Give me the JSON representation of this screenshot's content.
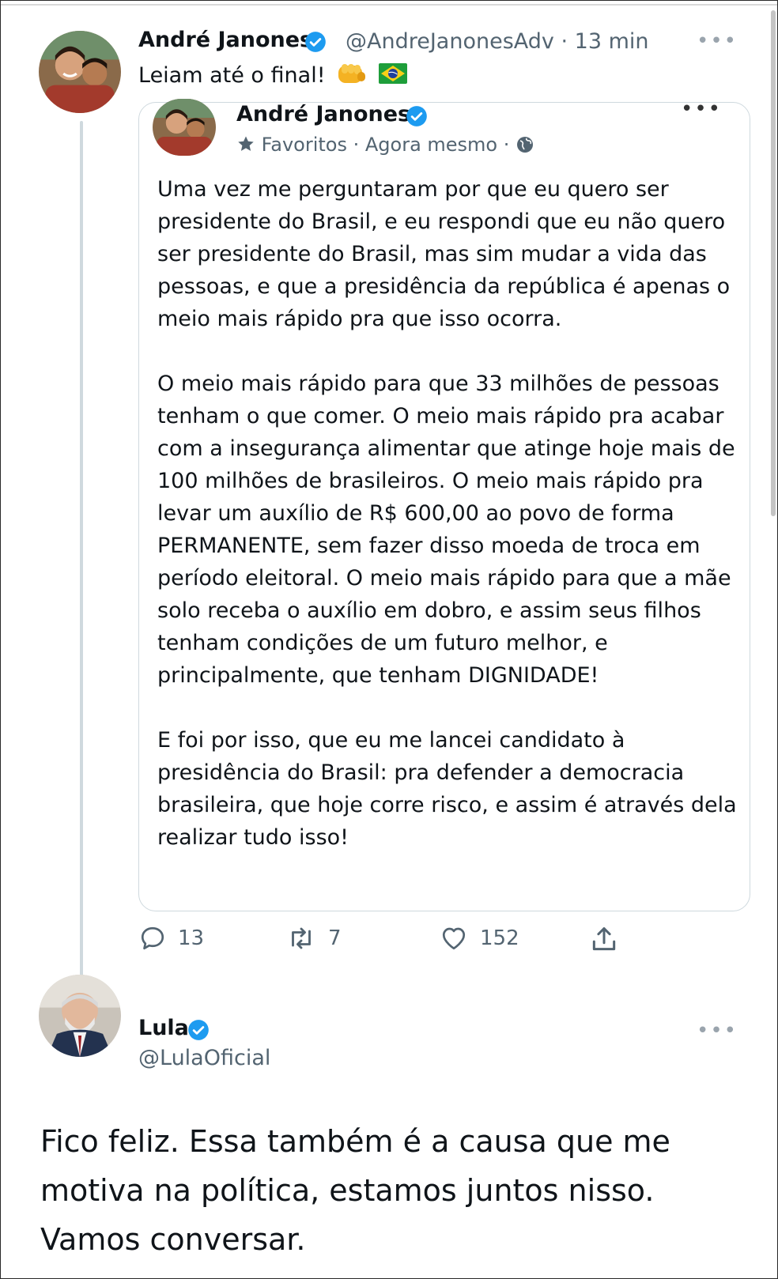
{
  "tweet": {
    "author_name": "André Janones",
    "handle": "@AndreJanonesAdv",
    "time": "· 13 min",
    "text": "Leiam até o final!",
    "emojis": [
      "fist-emoji",
      "brazil-flag-emoji"
    ],
    "more_label": "•••"
  },
  "quoted_tweet": {
    "author_name": "André Janones",
    "favorites_label": "Favoritos",
    "time": "· Agora mesmo ·",
    "more_label": "•••",
    "paragraphs": [
      "Uma vez me perguntaram por que eu quero ser presidente do Brasil, e eu respondi que eu não quero ser presidente do Brasil, mas sim mudar a vida das pessoas, e que a presidência da república é apenas o meio mais rápido pra que isso ocorra.",
      "O meio mais rápido para que 33 milhões de pessoas tenham o que comer. O meio mais rápido pra acabar com a insegurança alimentar que atinge hoje mais de 100 milhões de brasileiros. O meio mais rápido pra levar um auxílio de R$ 600,00 ao povo de forma PERMANENTE, sem fazer disso moeda de troca em período eleitoral. O meio mais rápido para que a mãe solo receba o auxílio em dobro, e assim seus filhos tenham condições de um futuro melhor, e principalmente, que tenham DIGNIDADE!",
      "E foi por isso, que eu me lancei candidato à presidência do Brasil: pra defender a democracia brasileira, que hoje corre risco, e assim é através dela realizar tudo isso!"
    ]
  },
  "actions": {
    "replies": "13",
    "retweets": "7",
    "likes": "152"
  },
  "reply": {
    "author_name": "Lula",
    "handle": "@LulaOficial",
    "more_label": "•••",
    "text": "Fico feliz. Essa também é a causa que me motiva na política, estamos juntos nisso. Vamos conversar."
  },
  "colors": {
    "verified_blue": "#1d9bf0",
    "muted_text": "#536471",
    "border": "#cfd9de"
  }
}
